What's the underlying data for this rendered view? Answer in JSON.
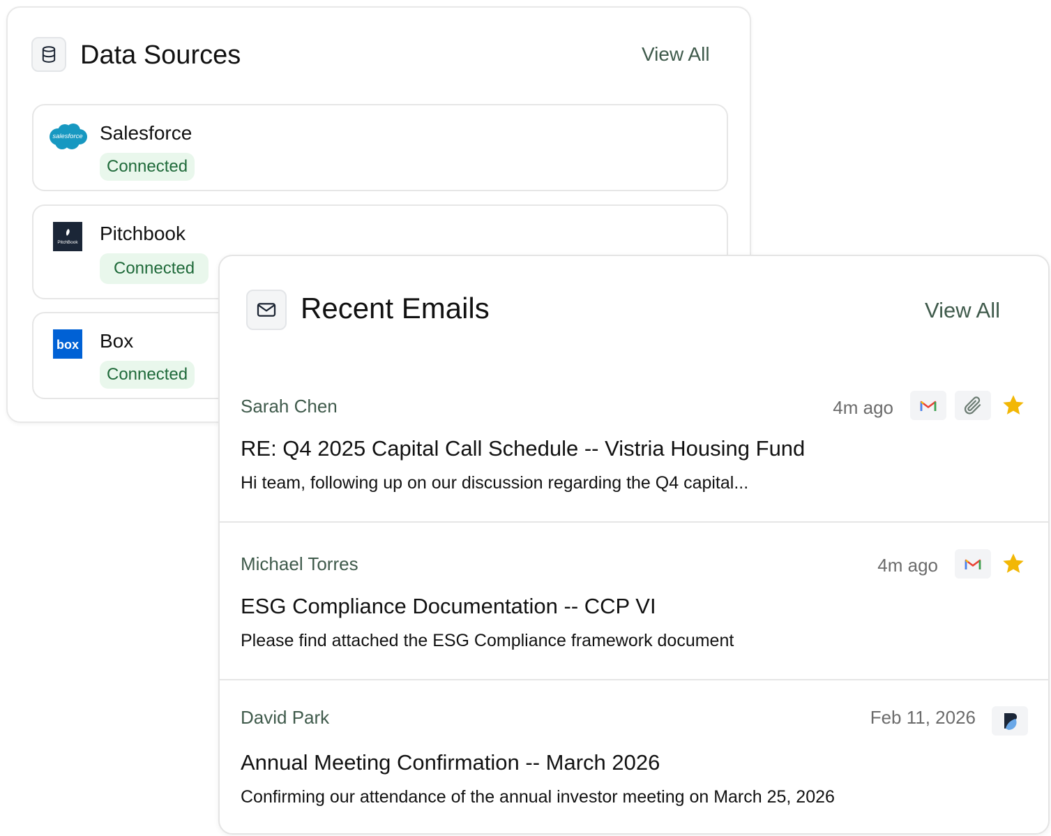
{
  "data_sources": {
    "title": "Data Sources",
    "view_all": "View All",
    "items": [
      {
        "name": "Salesforce",
        "status": "Connected",
        "logo_icon": "salesforce-logo",
        "logo_text": "salesforce"
      },
      {
        "name": "Pitchbook",
        "status": "Connected",
        "logo_icon": "pitchbook-logo",
        "logo_text": "PitchBook"
      },
      {
        "name": "Box",
        "status": "Connected",
        "logo_icon": "box-logo",
        "logo_text": "box"
      }
    ]
  },
  "recent_emails": {
    "title": "Recent Emails",
    "view_all": "View All",
    "items": [
      {
        "sender": "Sarah Chen",
        "time": "4m ago",
        "subject": "RE: Q4 2025 Capital Call Schedule -- Vistria Housing Fund",
        "preview": "Hi team, following up on our discussion regarding the Q4 capital...",
        "icons": [
          "gmail-icon",
          "attachment-icon",
          "star-icon"
        ]
      },
      {
        "sender": "Michael Torres",
        "time": "4m ago",
        "subject": "ESG Compliance Documentation -- CCP VI",
        "preview": "Please find attached the ESG Compliance framework document",
        "icons": [
          "gmail-icon",
          "star-icon"
        ]
      },
      {
        "sender": "David Park",
        "time": "Feb 11, 2026",
        "subject": "Annual Meeting Confirmation -- March 2026",
        "preview": "Confirming our attendance of the annual investor meeting on March 25, 2026",
        "icons": [
          "source-app-icon"
        ]
      }
    ]
  },
  "colors": {
    "accent_green": "#3f5a4b",
    "badge_bg": "#e9f7ec",
    "badge_text": "#1f6a3a",
    "star": "#f2b705",
    "salesforce_blue": "#1798c1",
    "box_blue": "#0061d5",
    "pitchbook_navy": "#1b2637"
  }
}
